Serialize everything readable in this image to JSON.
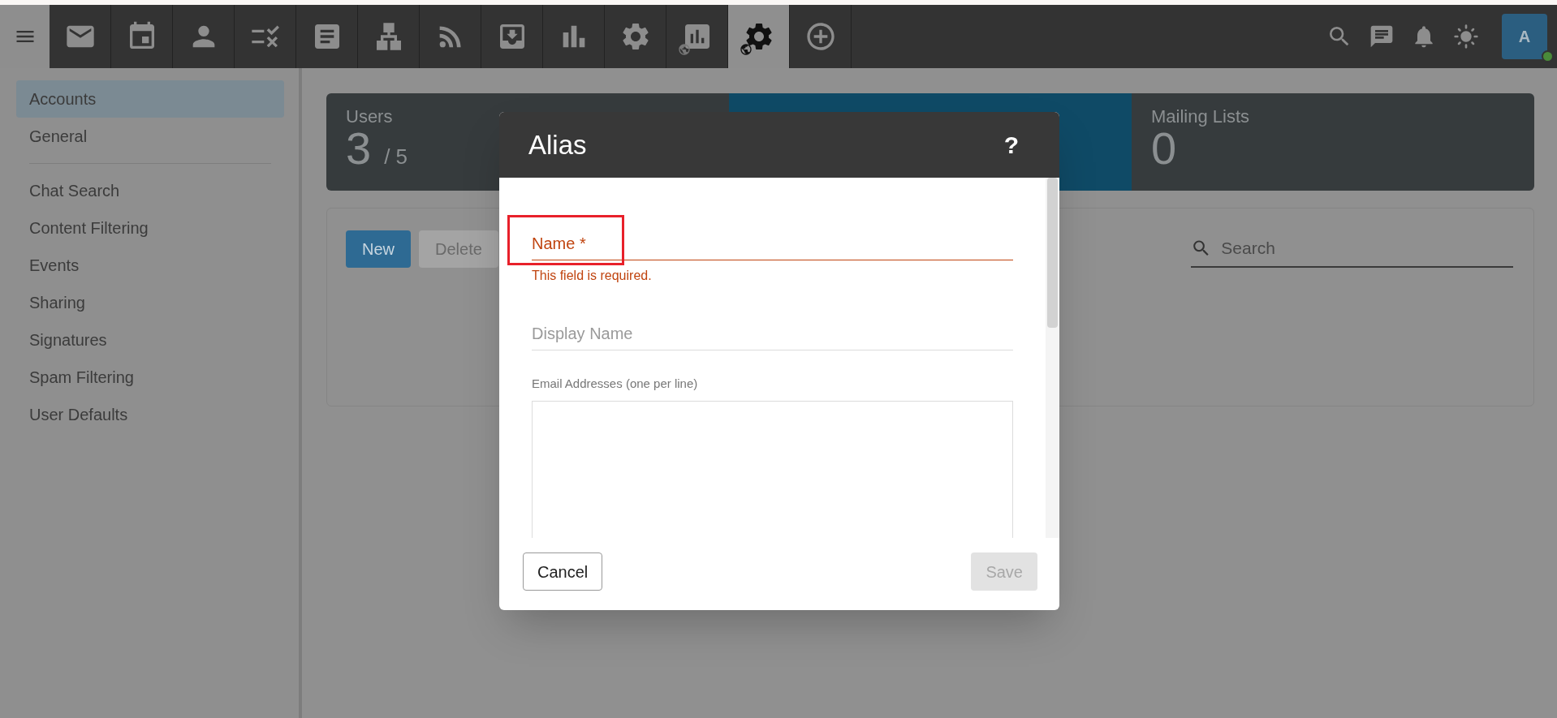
{
  "top_bar": {
    "nav_tabs": [
      {
        "selected": false
      },
      {
        "selected": false
      },
      {
        "selected": false
      },
      {
        "selected": false
      },
      {
        "selected": false
      },
      {
        "selected": false
      },
      {
        "selected": false
      },
      {
        "selected": false
      },
      {
        "selected": false
      },
      {
        "selected": false
      },
      {
        "selected": false
      },
      {
        "selected": true
      },
      {
        "selected": false
      }
    ],
    "avatar": {
      "initial": "A",
      "online": true
    }
  },
  "sidebar": {
    "groups": [
      [
        {
          "label": "Accounts",
          "selected": true
        },
        {
          "label": "General",
          "selected": false
        }
      ],
      [
        {
          "label": "Chat Search",
          "selected": false
        },
        {
          "label": "Content Filtering",
          "selected": false
        },
        {
          "label": "Events",
          "selected": false
        },
        {
          "label": "Sharing",
          "selected": false
        },
        {
          "label": "Signatures",
          "selected": false
        },
        {
          "label": "Spam Filtering",
          "selected": false
        },
        {
          "label": "User Defaults",
          "selected": false
        }
      ]
    ]
  },
  "stats": [
    {
      "kind": "dark",
      "label": "Users",
      "value": "3",
      "limit": "/ 5"
    },
    {
      "kind": "blue"
    },
    {
      "kind": "dark",
      "label": "Mailing Lists",
      "value": "0"
    }
  ],
  "toolbar": {
    "buttons": [
      {
        "label": "New",
        "disabled": false
      },
      {
        "label": "Delete",
        "disabled": true
      }
    ],
    "search": {
      "placeholder": "Search"
    }
  },
  "dialog": {
    "title": "Alias",
    "help": "?",
    "name_field": {
      "label": "Name *",
      "error": "This field is required.",
      "invalid": true,
      "highlighted": true
    },
    "display_name": {
      "placeholder": "Display Name"
    },
    "email_addresses": {
      "label": "Email Addresses (one per line)"
    },
    "buttons": [
      {
        "label": "Cancel",
        "disabled": false
      },
      {
        "label": "Save",
        "disabled": true
      }
    ]
  }
}
